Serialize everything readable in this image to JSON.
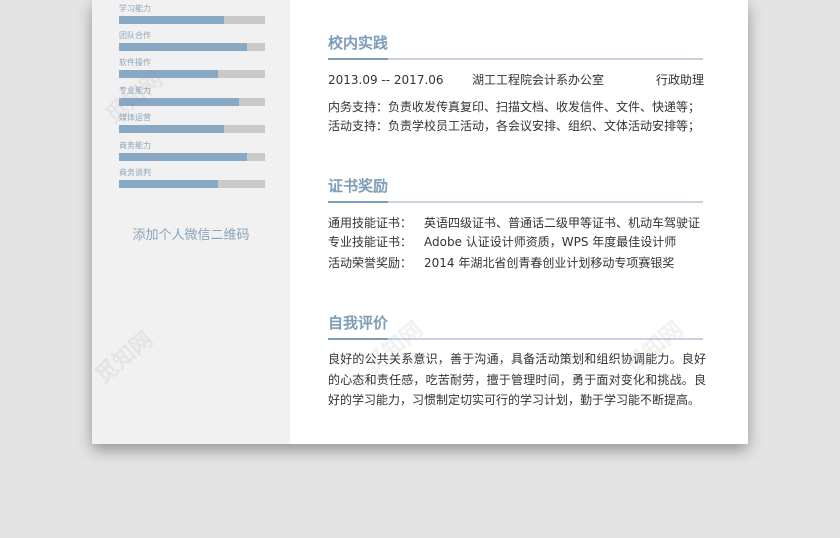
{
  "skills": [
    {
      "label": "学习能力",
      "level": 0.72
    },
    {
      "label": "团队合作",
      "level": 0.88
    },
    {
      "label": "软件操作",
      "level": 0.68
    },
    {
      "label": "专业能力",
      "level": 0.82
    },
    {
      "label": "媒体运营",
      "level": 0.72
    },
    {
      "label": "商务能力",
      "level": 0.88
    },
    {
      "label": "商务谈判",
      "level": 0.68
    }
  ],
  "qr_text": "添加个人微信二维码",
  "campus": {
    "title": "校内实践",
    "period": "2013.09 -- 2017.06",
    "org": "湖工工程院会计系办公室",
    "role": "行政助理",
    "line1": "内务支持：负责收发传真复印、扫描文档、收发信件、文件、快递等；",
    "line2": "活动支持：负责学校员工活动，各会议安排、组织、文体活动安排等；"
  },
  "certs": {
    "title": "证书奖励",
    "items": [
      {
        "label": "通用技能证书：",
        "value": "英语四级证书、普通话二级甲等证书、机动车驾驶证"
      },
      {
        "label": "专业技能证书：",
        "value": "Adobe 认证设计师资质，WPS 年度最佳设计师"
      },
      {
        "label": "活动荣誉奖励：",
        "value": "2014 年湖北省创青春创业计划移动专项赛银奖"
      }
    ]
  },
  "self": {
    "title": "自我评价",
    "text": "良好的公共关系意识，善于沟通，具备活动策划和组织协调能力。良好的心态和责任感，吃苦耐劳，擅于管理时间，勇于面对变化和挑战。良好的学习能力，习惯制定切实可行的学习计划，勤于学习能不断提高。"
  },
  "watermark": "觅知网",
  "colors": {
    "accent": "#7e9db8",
    "bar_fill": "#89a8c4",
    "bar_track": "#c9c9c9",
    "sidebar": "#f1f1f1"
  }
}
